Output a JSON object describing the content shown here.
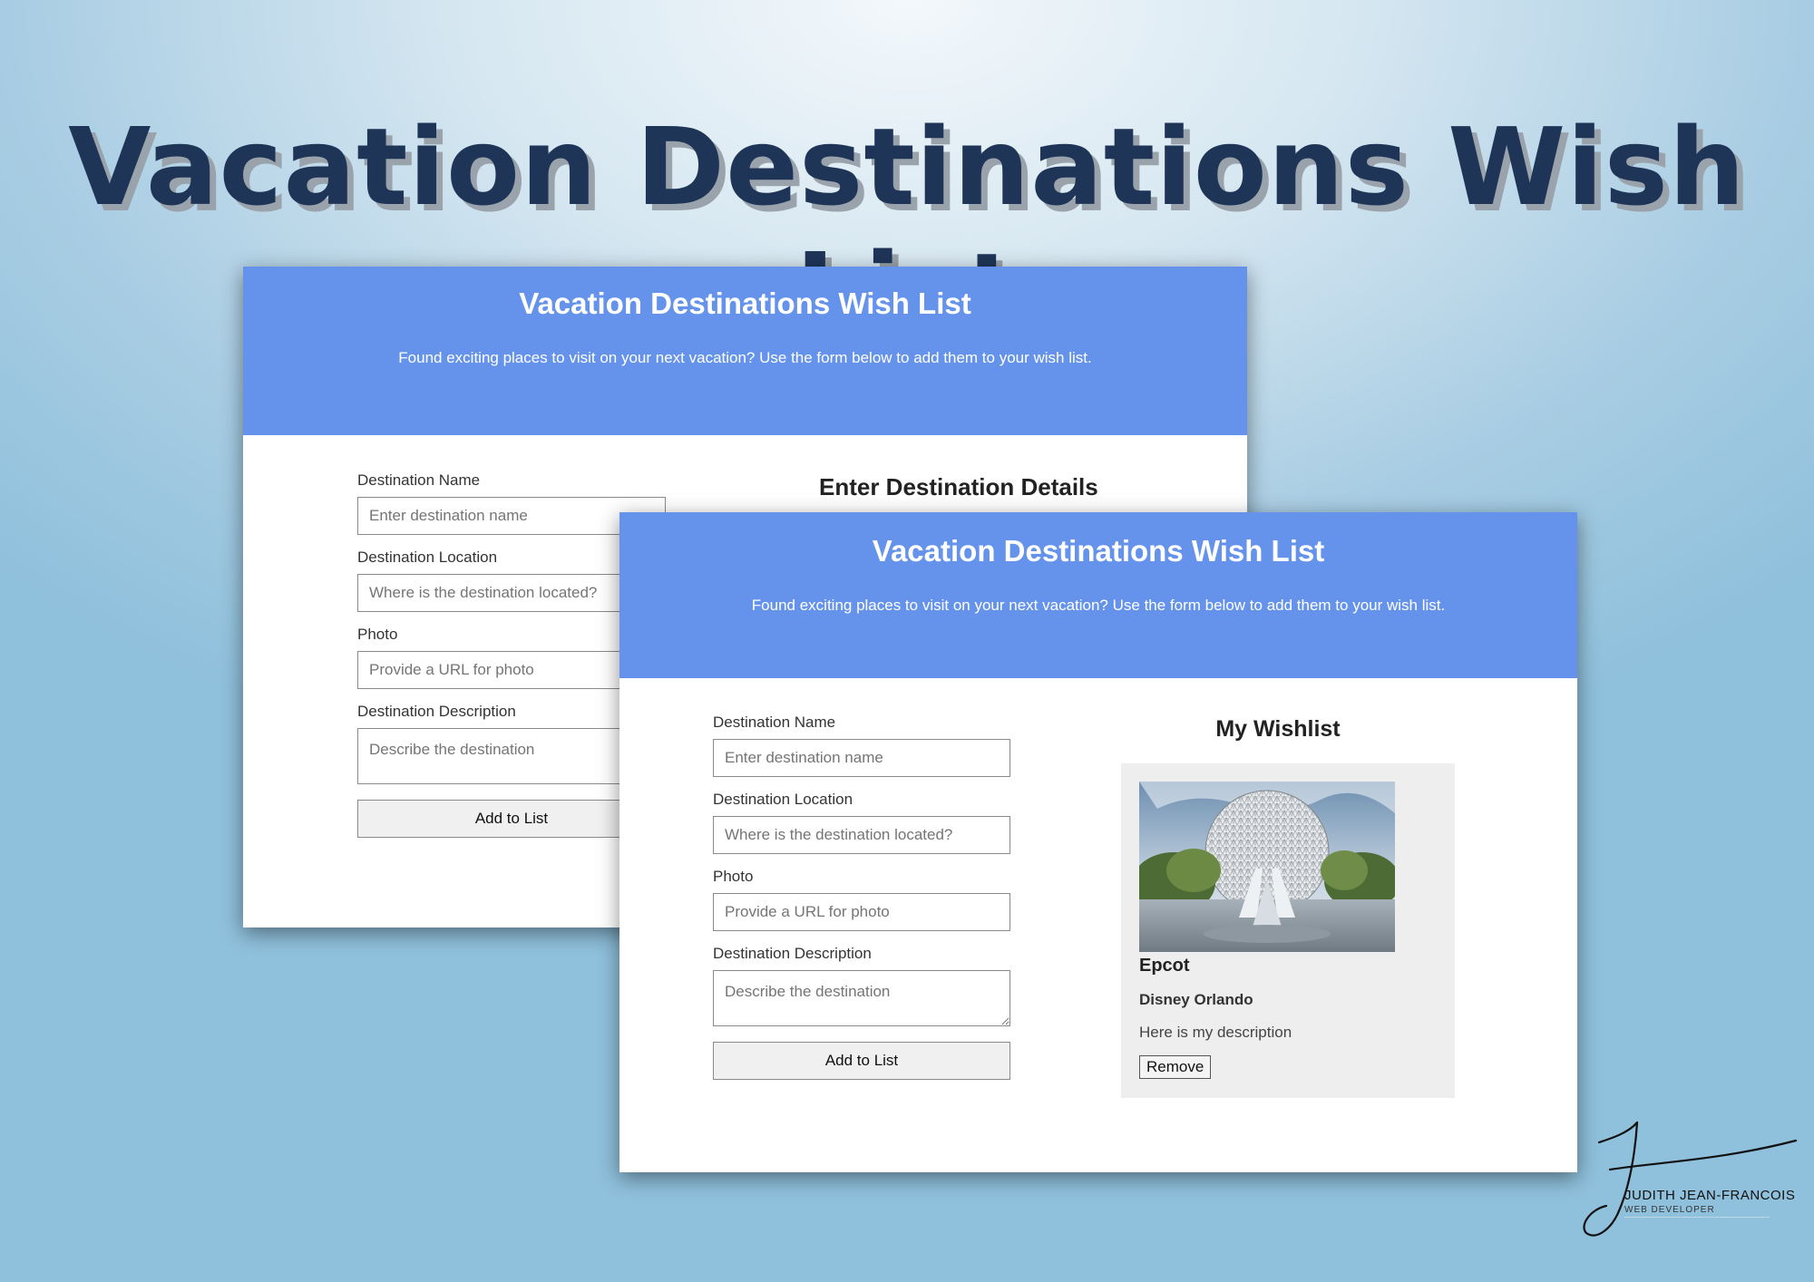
{
  "banner": {
    "title": "Vacation Destinations Wish List"
  },
  "back_screen": {
    "header_title": "Vacation Destinations Wish List",
    "header_sub": "Found exciting places to visit on your next vacation? Use the form below to add them to your wish list.",
    "form_heading": "Enter Destination Details",
    "labels": {
      "name": "Destination Name",
      "location": "Destination Location",
      "photo": "Photo",
      "description": "Destination Description"
    },
    "placeholders": {
      "name": "Enter destination name",
      "location": "Where is the destination located?",
      "photo": "Provide a URL for photo",
      "description": "Describe the destination"
    },
    "submit_label": "Add to List"
  },
  "front_screen": {
    "header_title": "Vacation Destinations Wish List",
    "header_sub": "Found exciting places to visit on your next vacation? Use the form below to add them to your wish list.",
    "labels": {
      "name": "Destination Name",
      "location": "Destination Location",
      "photo": "Photo",
      "description": "Destination Description"
    },
    "placeholders": {
      "name": "Enter destination name",
      "location": "Where is the destination located?",
      "photo": "Provide a URL for photo",
      "description": "Describe the destination"
    },
    "submit_label": "Add to List",
    "wishlist_heading": "My Wishlist",
    "card": {
      "photo_alt": "Epcot Spaceship Earth photo",
      "name": "Epcot",
      "location": "Disney Orlando",
      "description": "Here is my description",
      "remove_label": "Remove"
    }
  },
  "signature": {
    "name": "JUDITH JEAN-FRANCOIS",
    "role": "WEB DEVELOPER"
  },
  "colors": {
    "header_blue": "#6593eb",
    "title_navy": "#1f3558",
    "card_bg": "#eeeeee"
  }
}
